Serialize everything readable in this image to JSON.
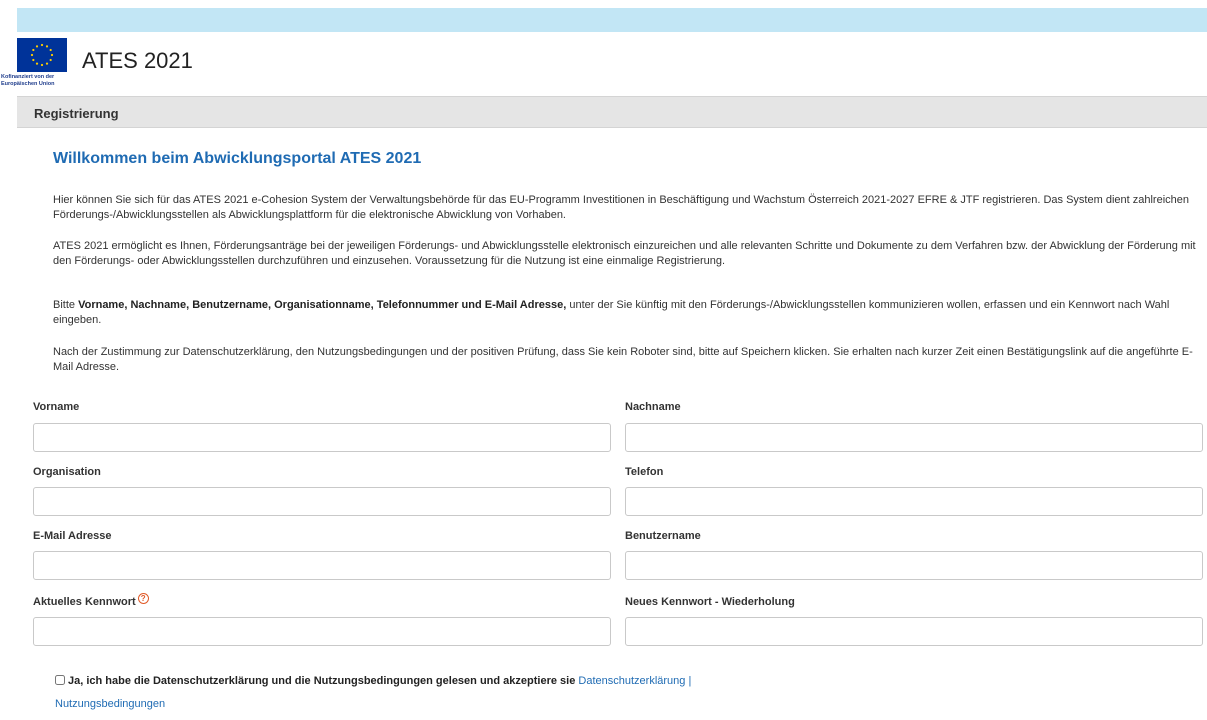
{
  "header": {
    "app_title": "ATES 2021",
    "eu_caption": "Kofinanziert von der Europäischen Union",
    "eu_color": "#003399",
    "star_color": "#ffcc00"
  },
  "section": {
    "title": "Registrierung"
  },
  "welcome": "Willkommen beim Abwicklungsportal ATES 2021",
  "intro": {
    "p1": "Hier können Sie sich für das ATES 2021 e-Cohesion System der Verwaltungsbehörde für das EU-Programm Investitionen in Beschäftigung und Wachstum Österreich 2021-2027 EFRE & JTF registrieren. Das System dient zahlreichen Förderungs-/Abwicklungsstellen als Abwicklungsplattform für die elektronische Abwicklung von Vorhaben.",
    "p2": "ATES 2021 ermöglicht es Ihnen, Förderungsanträge bei der jeweiligen Förderungs- und Abwicklungsstelle elektronisch einzureichen und alle relevanten Schritte und Dokumente zu dem Verfahren bzw. der Abwicklung der Förderung mit den Förderungs- oder Abwicklungsstellen durchzuführen und einzusehen. Voraussetzung für die Nutzung ist eine einmalige Registrierung.",
    "p3_prefix": "Bitte ",
    "p3_bold": "Vorname, Nachname, Benutzername, Organisationname, Telefonnummer und E-Mail Adresse,",
    "p3_suffix": " unter der Sie künftig mit den Förderungs-/Abwicklungsstellen kommunizieren wollen, erfassen und ein Kennwort nach Wahl eingeben.",
    "p4": "Nach der Zustimmung zur Datenschutzerklärung, den Nutzungsbedingungen und der positiven Prüfung, dass Sie kein Roboter sind, bitte auf Speichern klicken. Sie erhalten nach kurzer Zeit einen Bestätigungslink auf die angeführte E-Mail Adresse."
  },
  "form": {
    "vorname_label": "Vorname",
    "vorname_value": "",
    "nachname_label": "Nachname",
    "nachname_value": "",
    "organisation_label": "Organisation",
    "organisation_value": "",
    "telefon_label": "Telefon",
    "telefon_value": "",
    "email_label": "E-Mail Adresse",
    "email_value": "",
    "benutzername_label": "Benutzername",
    "benutzername_value": "",
    "kennwort_label": "Aktuelles Kennwort",
    "kennwort_help_icon": "question-circle-icon",
    "kennwort_help_glyph": "?",
    "kennwort_repeat_label": "Neues Kennwort - Wiederholung"
  },
  "consent": {
    "text": "Ja, ich habe die Datenschutzerklärung und die Nutzungsbedingungen gelesen und akzeptiere sie",
    "privacy_link": "Datenschutzerklärung",
    "separator": "|",
    "terms_link": "Nutzungsbedingungen",
    "checked": false
  },
  "colors": {
    "topbar": "#c2e6f5",
    "section_bar": "#e5e5e5",
    "link": "#1f6bb3",
    "heading": "#1f6bb3",
    "help_icon": "#e05a28"
  }
}
